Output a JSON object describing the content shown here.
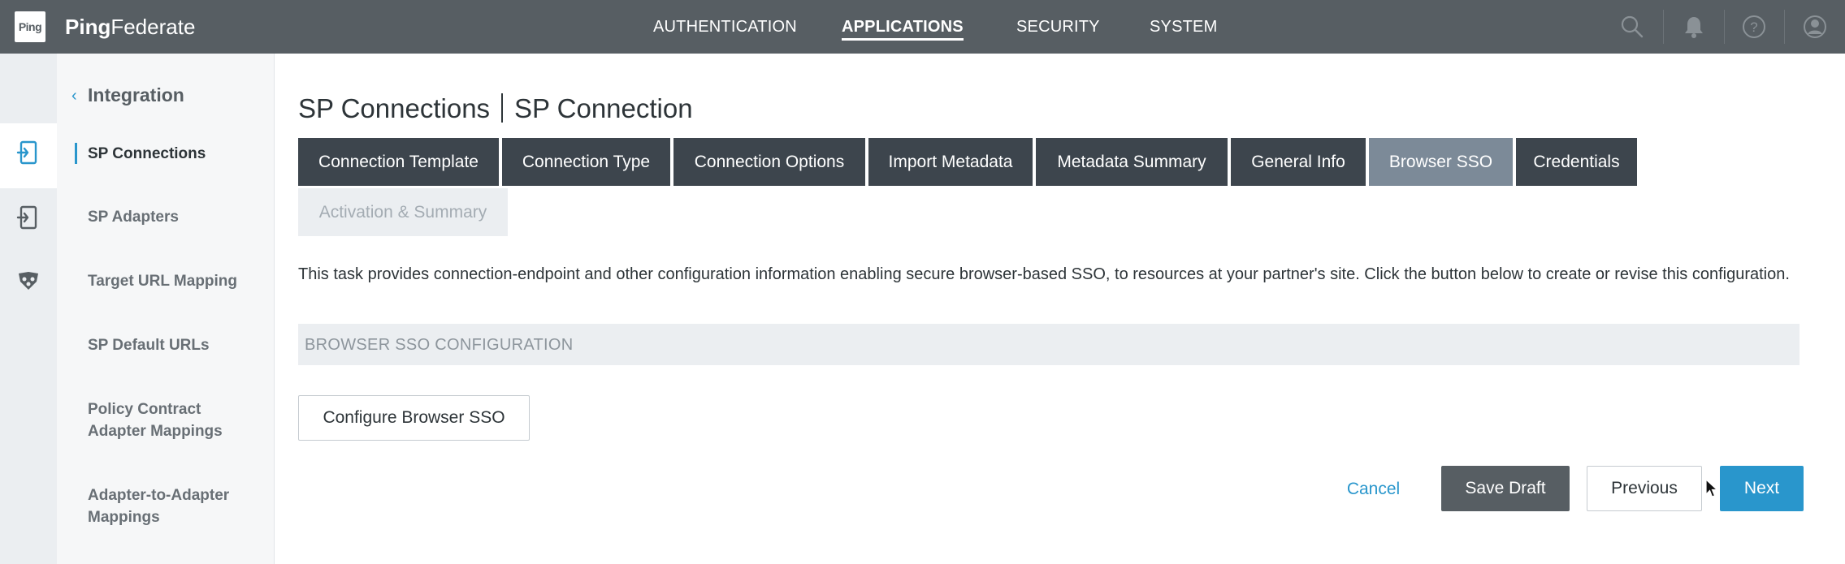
{
  "brand": {
    "logo_text": "Ping",
    "name_bold": "Ping",
    "name_light": "Federate"
  },
  "topnav": {
    "items": [
      {
        "label": "AUTHENTICATION",
        "active": false
      },
      {
        "label": "APPLICATIONS",
        "active": true
      },
      {
        "label": "SECURITY",
        "active": false
      },
      {
        "label": "SYSTEM",
        "active": false
      }
    ],
    "icons": [
      "search-icon",
      "bell-icon",
      "help-icon",
      "user-icon"
    ]
  },
  "rail": {
    "icons": [
      "sp-connections-icon",
      "sp-adapters-icon",
      "network-icon"
    ]
  },
  "sidebar": {
    "back_label": "Integration",
    "items": [
      {
        "label": "SP Connections",
        "active": true
      },
      {
        "label": "SP Adapters",
        "active": false
      },
      {
        "label": "Target URL Mapping",
        "active": false
      },
      {
        "label": "SP Default URLs",
        "active": false
      },
      {
        "label": "Policy Contract Adapter Mappings",
        "active": false
      },
      {
        "label": "Adapter-to-Adapter Mappings",
        "active": false
      }
    ]
  },
  "main": {
    "title_primary": "SP Connections",
    "title_secondary": "SP Connection",
    "tabs": [
      {
        "label": "Connection Template",
        "state": "done"
      },
      {
        "label": "Connection Type",
        "state": "done"
      },
      {
        "label": "Connection Options",
        "state": "done"
      },
      {
        "label": "Import Metadata",
        "state": "done"
      },
      {
        "label": "Metadata Summary",
        "state": "done"
      },
      {
        "label": "General Info",
        "state": "done"
      },
      {
        "label": "Browser SSO",
        "state": "current"
      },
      {
        "label": "Credentials",
        "state": "done"
      },
      {
        "label": "Activation & Summary",
        "state": "disabled"
      }
    ],
    "description": "This task provides connection-endpoint and other configuration information enabling secure browser-based SSO, to resources at your partner's site. Click the button below to create or revise this configuration.",
    "section_title": "BROWSER SSO CONFIGURATION",
    "configure_button": "Configure Browser SSO"
  },
  "footer": {
    "cancel": "Cancel",
    "save_draft": "Save Draft",
    "previous": "Previous",
    "next": "Next"
  },
  "colors": {
    "topnav_bg": "#575e63",
    "tab_bg": "#3d454d",
    "tab_current": "#7c8a98",
    "accent": "#2996cc",
    "rail_bg": "#ebeef1"
  }
}
